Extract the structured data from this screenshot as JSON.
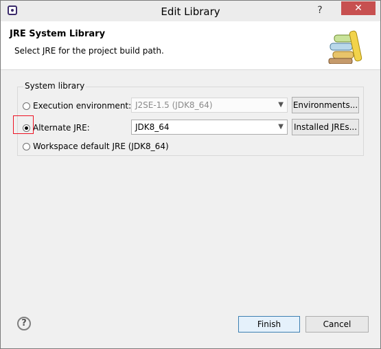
{
  "window": {
    "title": "Edit Library",
    "help_label": "?",
    "close_label": "✕"
  },
  "banner": {
    "title": "JRE System Library",
    "description": "Select JRE for the project build path."
  },
  "group": {
    "label": "System library",
    "execution_env": {
      "label": "Execution environment:",
      "value": "J2SE-1.5 (JDK8_64)",
      "button": "Environments..."
    },
    "alternate_jre": {
      "label": "Alternate JRE:",
      "value": "JDK8_64",
      "button": "Installed JREs..."
    },
    "workspace_default": {
      "label": "Workspace default JRE (JDK8_64)"
    }
  },
  "footer": {
    "help": "?",
    "finish": "Finish",
    "cancel": "Cancel"
  },
  "colors": {
    "highlight": "#e11122",
    "close_button": "#c75050",
    "default_button_border": "#3c7fb1"
  }
}
